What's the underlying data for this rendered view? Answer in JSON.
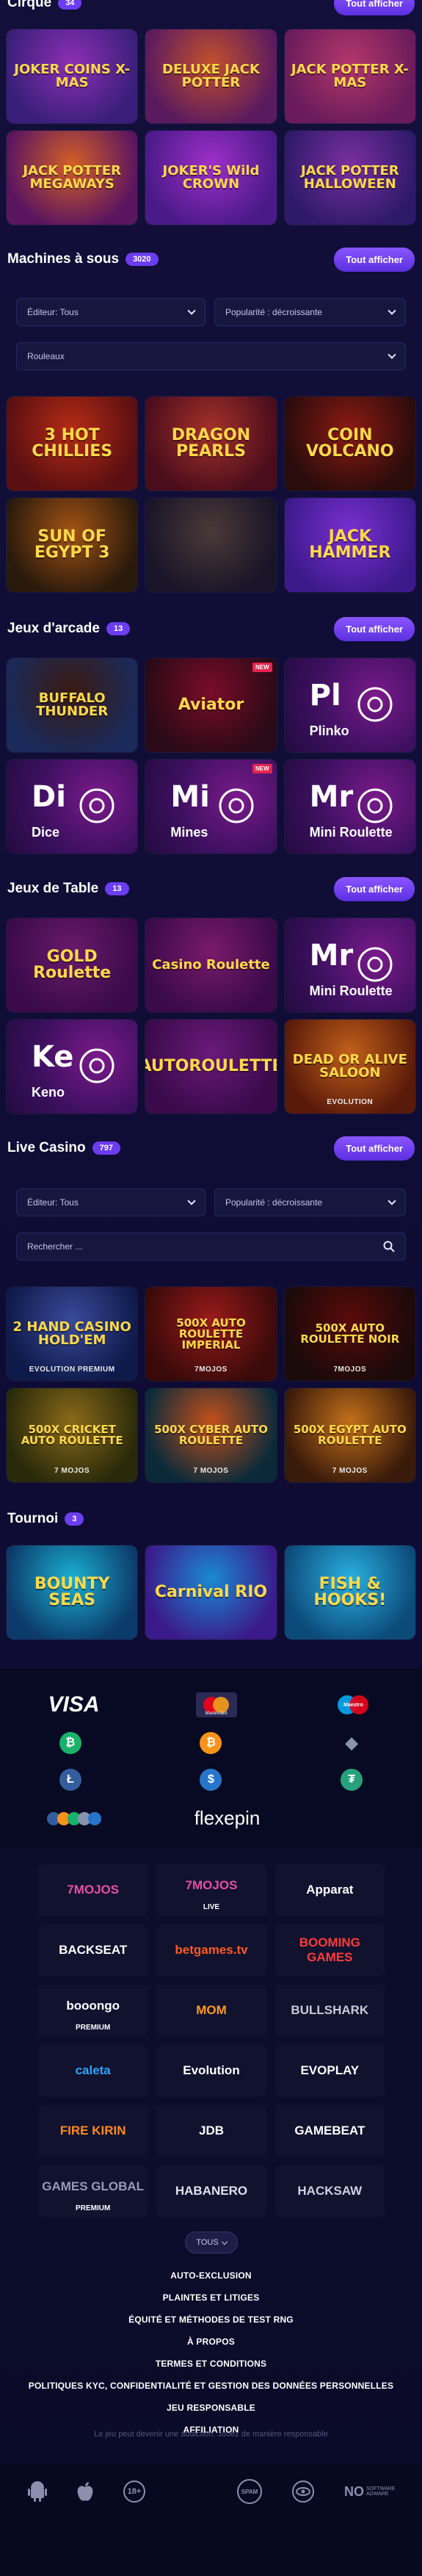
{
  "sections": {
    "cirque": {
      "title": "Cirque",
      "count": "34",
      "show_all": "Tout afficher"
    },
    "machines": {
      "title": "Machines à sous",
      "count": "3020",
      "show_all": "Tout afficher"
    },
    "arcade": {
      "title": "Jeux d'arcade",
      "count": "13",
      "show_all": "Tout afficher"
    },
    "table": {
      "title": "Jeux de Table",
      "count": "13",
      "show_all": "Tout afficher"
    },
    "live": {
      "title": "Live Casino",
      "count": "797",
      "show_all": "Tout afficher"
    },
    "tournoi": {
      "title": "Tournoi",
      "count": "3"
    }
  },
  "cirque_games": [
    {
      "title": "JOKER COINS X-MAS",
      "bg1": "#3a1f7a",
      "bg2": "#8c2fb3"
    },
    {
      "title": "DELUXE JACK POTTER",
      "bg1": "#5a1a5f",
      "bg2": "#c24f2c"
    },
    {
      "title": "JACK POTTER X-MAS",
      "bg1": "#6a1b5b",
      "bg2": "#b3376a"
    },
    {
      "title": "JACK POTTER MEGAWAYS",
      "bg1": "#5a1460",
      "bg2": "#d35f26"
    },
    {
      "title": "JOKER'S Wild CROWN",
      "bg1": "#4a1a88",
      "bg2": "#9e2fc9"
    },
    {
      "title": "JACK POTTER HALLOWEEN",
      "bg1": "#2f1a6a",
      "bg2": "#7a2fa0"
    }
  ],
  "machines_filters": {
    "editor_label": "Éditeur: Tous",
    "popularity_label": "Popularité : décroissante",
    "reels_label": "Rouleaux"
  },
  "machines_games": [
    {
      "title": "3 HOT CHILLIES",
      "bg1": "#5a0f12",
      "bg2": "#b52b14"
    },
    {
      "title": "DRAGON PEARLS",
      "bg1": "#4a0d1c",
      "bg2": "#a6312a"
    },
    {
      "title": "COIN VOLCANO",
      "bg1": "#2a0c0c",
      "bg2": "#8c1a12"
    },
    {
      "title": "SUN OF EGYPT 3",
      "bg1": "#2a1a0c",
      "bg2": "#a35314"
    },
    {
      "title": "",
      "bg1": "#1a1428",
      "bg2": "#4a3a38"
    },
    {
      "title": "JACK HAMMER",
      "bg1": "#3d1a8c",
      "bg2": "#7a2fd1"
    }
  ],
  "arcade_games": [
    {
      "type": "image",
      "title": "BUFFALO THUNDER",
      "bg1": "#1a2a5a",
      "bg2": "#3a1a12"
    },
    {
      "type": "image",
      "title": "Aviator",
      "bg1": "#2a0a16",
      "bg2": "#7a0c2a",
      "new": "NEW"
    },
    {
      "type": "letter",
      "abbr": "Pl",
      "full": "Plinko"
    },
    {
      "type": "letter",
      "abbr": "Di",
      "full": "Dice"
    },
    {
      "type": "letter",
      "abbr": "Mi",
      "full": "Mines",
      "new": "NEW"
    },
    {
      "type": "letter",
      "abbr": "Mr",
      "full": "Mini Roulette"
    }
  ],
  "table_games": [
    {
      "type": "image",
      "title": "GOLD Roulette",
      "bg1": "#3a0a4a",
      "bg2": "#6a1a6a"
    },
    {
      "type": "image",
      "title": "Casino Roulette",
      "bg1": "#3a0a4a",
      "bg2": "#7a1a6a"
    },
    {
      "type": "letter",
      "abbr": "Mr",
      "full": "Mini Roulette"
    },
    {
      "type": "letter",
      "abbr": "Ke",
      "full": "Keno"
    },
    {
      "type": "image",
      "title": "AUTOROULETTE",
      "bg1": "#3a0a4a",
      "bg2": "#6a1a7a"
    },
    {
      "type": "image",
      "title": "DEAD OR ALIVE SALOON",
      "sub": "EVOLUTION",
      "bg1": "#5a1a0a",
      "bg2": "#c2601a"
    }
  ],
  "live_filters": {
    "editor_label": "Éditeur: Tous",
    "popularity_label": "Popularité : décroissante",
    "search_placeholder": "Rechercher ..."
  },
  "live_games": [
    {
      "title": "2 HAND CASINO HOLD'EM",
      "sub": "EVOLUTION PREMIUM",
      "bg1": "#0e1a4a",
      "bg2": "#3a4a9a"
    },
    {
      "title": "500X AUTO ROULETTE IMPERIAL",
      "sub": "7MOJOS",
      "bg1": "#3a0a0a",
      "bg2": "#9a1a1a"
    },
    {
      "title": "500X AUTO ROULETTE NOIR",
      "sub": "7MOJOS",
      "bg1": "#1a0a0a",
      "bg2": "#5a0a0a"
    },
    {
      "title": "500X CRICKET AUTO ROULETTE",
      "sub": "7 MOJOS",
      "bg1": "#2a2a0a",
      "bg2": "#8a6a1a"
    },
    {
      "title": "500X CYBER AUTO ROULETTE",
      "sub": "7 MOJOS",
      "bg1": "#0a2a3a",
      "bg2": "#c2501a"
    },
    {
      "title": "500X EGYPT AUTO ROULETTE",
      "sub": "7 MOJOS",
      "bg1": "#3a1a0a",
      "bg2": "#c2701a"
    }
  ],
  "tournoi_games": [
    {
      "title": "BOUNTY SEAS",
      "bg1": "#0c3a6a",
      "bg2": "#1ab0d1"
    },
    {
      "title": "Carnival RIO",
      "bg1": "#3a1a8a",
      "bg2": "#1a8ad1"
    },
    {
      "title": "FISH & HOOKS!",
      "bg1": "#0c4a7a",
      "bg2": "#2ab0e0"
    }
  ],
  "payments": {
    "visa": "VISA",
    "mastercard": "Mastercard",
    "maestro": "Maestro",
    "flexepin": "flexepin",
    "coin_colors": {
      "bitcoin_cash": "#18b26b",
      "bitcoin": "#f7931a",
      "ethereum": "#8a92b2",
      "litecoin": "#345d9d",
      "usdc": "#2775ca",
      "tether": "#26a17b"
    }
  },
  "providers": [
    {
      "name": "7MOJOS",
      "color": "#e94fa6"
    },
    {
      "name": "7MOJOS",
      "mini": "LIVE",
      "color": "#e94fa6"
    },
    {
      "name": "Apparat",
      "color": "#ffffff"
    },
    {
      "name": "BACKSEAT",
      "color": "#ffffff"
    },
    {
      "name": "betgames.tv",
      "color": "#ff5a1f"
    },
    {
      "name": "BOOMING GAMES",
      "color": "#ff3b3b"
    },
    {
      "name": "booongo",
      "mini": "PREMIUM",
      "color": "#ffffff"
    },
    {
      "name": "MOM",
      "color": "#ff9a1a"
    },
    {
      "name": "BULLSHARK",
      "color": "#c8c8d8"
    },
    {
      "name": "caleta",
      "color": "#2aa6ff"
    },
    {
      "name": "Evolution",
      "color": "#ffffff"
    },
    {
      "name": "EVOPLAY",
      "color": "#ffffff"
    },
    {
      "name": "FIRE KIRIN",
      "color": "#ff8a1a"
    },
    {
      "name": "JDB",
      "color": "#ffffff"
    },
    {
      "name": "GAMEBEAT",
      "color": "#ffffff"
    },
    {
      "name": "GAMES GLOBAL",
      "mini": "PREMIUM",
      "color": "#9a9ab8"
    },
    {
      "name": "HABANERO",
      "color": "#e0e0f0"
    },
    {
      "name": "HACKSAW",
      "color": "#d0d0e0"
    }
  ],
  "tous_label": "TOUS",
  "footer_links": [
    "AUTO-EXCLUSION",
    "PLAINTES ET LITIGES",
    "ÉQUITÉ ET MÉTHODES DE TEST RNG",
    "À PROPOS",
    "TERMES ET CONDITIONS",
    "POLITIQUES KYC, CONFIDENTIALITÉ ET GESTION DES DONNÉES PERSONNELLES",
    "JEU RESPONSABLE",
    "AFFILIATION"
  ],
  "disclaimer": "Le jeu peut devenir une addiction. Jouez de manière responsable",
  "bottom_icons": {
    "age": "18+",
    "spam": "SPAM",
    "no_software": "NO",
    "no_software_sub": "SOFTWARE ADWARE"
  },
  "colors": {
    "accent": "#6c3df0",
    "background": "#0e0c33",
    "new_badge": "#e3254f"
  }
}
